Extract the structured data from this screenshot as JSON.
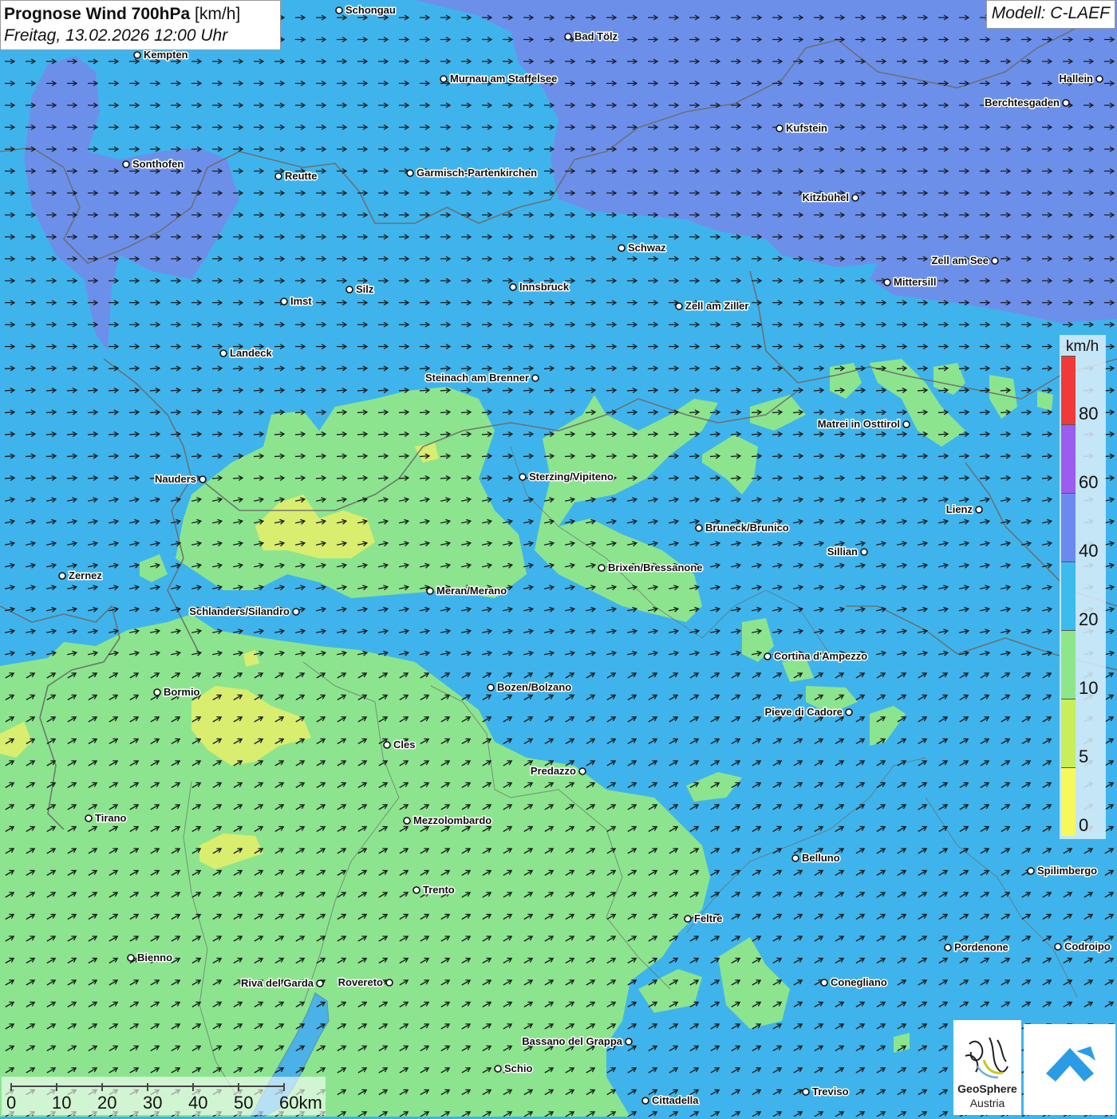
{
  "header": {
    "title_bold": "Prognose Wind 700hPa",
    "title_unit": "[km/h]",
    "date": "Freitag, 13.02.2026 12:00 Uhr"
  },
  "model": {
    "label": "Modell: C-LAEF"
  },
  "legend": {
    "unit": "km/h",
    "segments": [
      {
        "color": "#f03a3a"
      },
      {
        "color": "#9b5cf0"
      },
      {
        "color": "#6a8af0"
      },
      {
        "color": "#3bbcec"
      },
      {
        "color": "#8ee68a"
      },
      {
        "color": "#c8ee5a"
      },
      {
        "color": "#f8f85a"
      }
    ],
    "ticks": [
      "80",
      "60",
      "40",
      "20",
      "10",
      "5",
      "0"
    ]
  },
  "scalebar": {
    "labels": [
      "0",
      "10",
      "20",
      "30",
      "40",
      "50",
      "60km"
    ]
  },
  "logos": {
    "geosphere_line1": "GeoSphere",
    "geosphere_line2": "Austria",
    "geosphere_icon": "geosphere-logo-icon",
    "partner_icon": "blue-arrow-logo-icon"
  },
  "colors": {
    "wind_10_20": "#3fb4ec",
    "wind_20_40": "#6f8eea",
    "wind_5_10": "#8ee68a",
    "wind_0_5": "#e6ee6a",
    "arrow": "#1a1a1a",
    "border": "#6b6b6b"
  },
  "cities": [
    {
      "name": "Schongau"
    },
    {
      "name": "Kempten"
    },
    {
      "name": "Bad Tölz"
    },
    {
      "name": "Murnau am Staffelsee"
    },
    {
      "name": "Hallein"
    },
    {
      "name": "Berchtesgaden"
    },
    {
      "name": "Kufstein"
    },
    {
      "name": "Sonthofen"
    },
    {
      "name": "Reutte"
    },
    {
      "name": "Garmisch-Partenkirchen"
    },
    {
      "name": "Kitzbühel"
    },
    {
      "name": "Schwaz"
    },
    {
      "name": "Zell am See"
    },
    {
      "name": "Mittersill"
    },
    {
      "name": "Innsbruck"
    },
    {
      "name": "Silz"
    },
    {
      "name": "Imst"
    },
    {
      "name": "Zell am Ziller"
    },
    {
      "name": "Landeck"
    },
    {
      "name": "Steinach am Brenner"
    },
    {
      "name": "Matrei in Osttirol"
    },
    {
      "name": "Nauders"
    },
    {
      "name": "Sterzing/Vipiteno"
    },
    {
      "name": "Lienz"
    },
    {
      "name": "Bruneck/Brunico"
    },
    {
      "name": "Sillian"
    },
    {
      "name": "Zernez"
    },
    {
      "name": "Brixen/Bressanone"
    },
    {
      "name": "Meran/Merano"
    },
    {
      "name": "Schlanders/Silandro"
    },
    {
      "name": "Cortina d'Ampezzo"
    },
    {
      "name": "Bormio"
    },
    {
      "name": "Bozen/Bolzano"
    },
    {
      "name": "Pieve di Cadore"
    },
    {
      "name": "Cles"
    },
    {
      "name": "Predazzo"
    },
    {
      "name": "Tirano"
    },
    {
      "name": "Mezzolombardo"
    },
    {
      "name": "Belluno"
    },
    {
      "name": "Spilimbergo"
    },
    {
      "name": "Trento"
    },
    {
      "name": "Feltre"
    },
    {
      "name": "Bienno"
    },
    {
      "name": "Pordenone"
    },
    {
      "name": "Codroipo"
    },
    {
      "name": "Riva del Garda"
    },
    {
      "name": "Rovereto"
    },
    {
      "name": "Conegliano"
    },
    {
      "name": "Bassano del Grappa"
    },
    {
      "name": "Schio"
    },
    {
      "name": "Treviso"
    },
    {
      "name": "Cittadella"
    }
  ]
}
